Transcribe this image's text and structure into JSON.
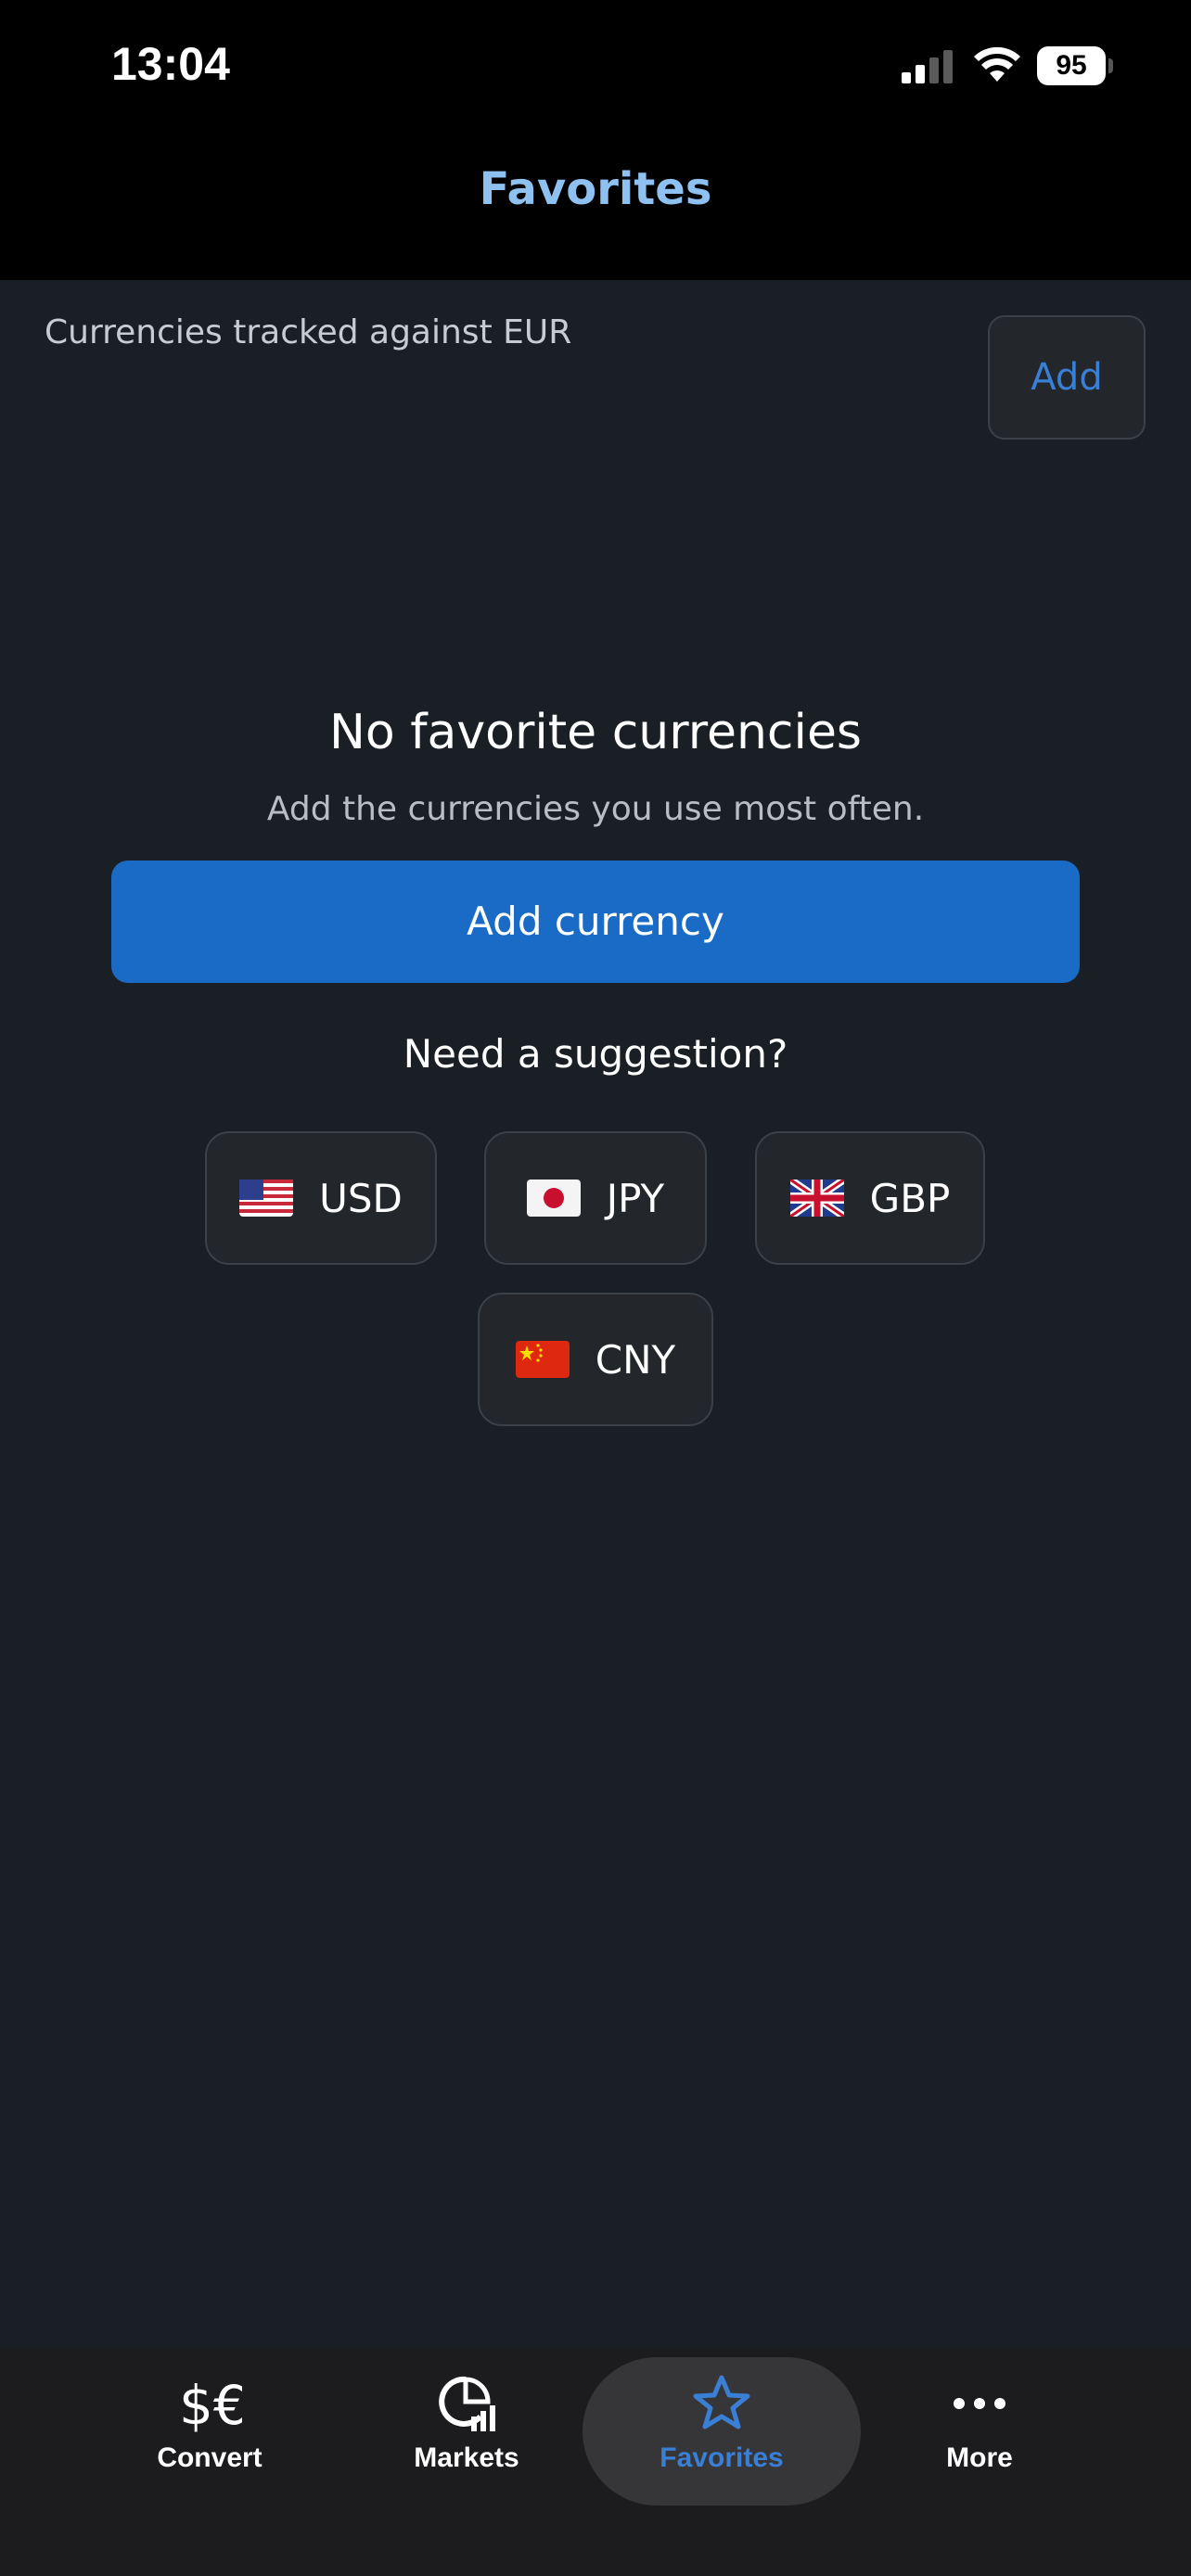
{
  "status_bar": {
    "time": "13:04",
    "battery": "95",
    "icons": [
      "signal-icon",
      "wifi-icon",
      "battery-icon"
    ]
  },
  "header": {
    "title": "Favorites"
  },
  "main": {
    "tracked_label": "Currencies tracked against EUR",
    "add_button": "Add",
    "empty_title": "No favorite currencies",
    "empty_subtitle": "Add the currencies you use most often.",
    "add_currency_button": "Add currency",
    "suggestion_title": "Need a suggestion?",
    "suggestions": [
      {
        "code": "USD",
        "icon": "us-flag-icon"
      },
      {
        "code": "JPY",
        "icon": "jp-flag-icon"
      },
      {
        "code": "GBP",
        "icon": "gb-flag-icon"
      },
      {
        "code": "CNY",
        "icon": "cn-flag-icon"
      }
    ]
  },
  "tab_bar": {
    "tabs": [
      {
        "label": "Convert",
        "icon": "dollar-euro-icon",
        "active": false
      },
      {
        "label": "Markets",
        "icon": "markets-chart-icon",
        "active": false
      },
      {
        "label": "Favorites",
        "icon": "star-icon",
        "active": true
      },
      {
        "label": "More",
        "icon": "more-dots-icon",
        "active": false
      }
    ]
  },
  "colors": {
    "accent": "#3a7fd6",
    "title": "#8ec1f0",
    "primary_button": "#1a6bc6",
    "background": "#1a1f25"
  }
}
